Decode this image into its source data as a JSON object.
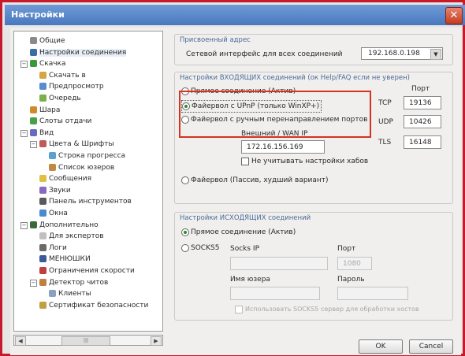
{
  "window": {
    "title": "Настройки"
  },
  "tree": [
    {
      "label": "Общие",
      "icon": "gear-icon",
      "color": "#8a8a8a"
    },
    {
      "label": "Настройки соединения",
      "icon": "network-icon",
      "color": "#3a6ea5"
    },
    {
      "label": "Скачка",
      "icon": "download-icon",
      "color": "#3a9a3a"
    },
    {
      "label": "Скачать в",
      "icon": "folder-icon",
      "color": "#d4a640"
    },
    {
      "label": "Предпросмотр",
      "icon": "preview-icon",
      "color": "#5a8ad0"
    },
    {
      "label": "Очередь",
      "icon": "queue-icon",
      "color": "#7ab04a"
    },
    {
      "label": "Шара",
      "icon": "share-icon",
      "color": "#d08a2a"
    },
    {
      "label": "Слоты отдачи",
      "icon": "upload-icon",
      "color": "#4aa04a"
    },
    {
      "label": "Вид",
      "icon": "view-icon",
      "color": "#6a6ac0"
    },
    {
      "label": "Цвета & Шрифты",
      "icon": "palette-icon",
      "color": "#c05a5a"
    },
    {
      "label": "Строка прогресса",
      "icon": "progress-icon",
      "color": "#5aa0d0"
    },
    {
      "label": "Список юзеров",
      "icon": "users-icon",
      "color": "#c08a40"
    },
    {
      "label": "Сообщения",
      "icon": "message-icon",
      "color": "#e0c040"
    },
    {
      "label": "Звуки",
      "icon": "sound-icon",
      "color": "#8a6ac0"
    },
    {
      "label": "Панель инструментов",
      "icon": "toolbar-icon",
      "color": "#5a5a5a"
    },
    {
      "label": "Окна",
      "icon": "windows-icon",
      "color": "#4a8ad0"
    },
    {
      "label": "Дополнительно",
      "icon": "advanced-icon",
      "color": "#3a6a3a"
    },
    {
      "label": "Для экспертов",
      "icon": "expert-icon",
      "color": "#c0c0c0"
    },
    {
      "label": "Логи",
      "icon": "log-icon",
      "color": "#6a6a6a"
    },
    {
      "label": "МЕНЮШКИ",
      "icon": "menu-icon",
      "color": "#3a5a9a"
    },
    {
      "label": "Ограничения скорости",
      "icon": "speed-icon",
      "color": "#c04040"
    },
    {
      "label": "Детектор читов",
      "icon": "detector-icon",
      "color": "#c08040"
    },
    {
      "label": "Клиенты",
      "icon": "clients-icon",
      "color": "#8aa0c0"
    },
    {
      "label": "Сертификат безопасности",
      "icon": "certificate-icon",
      "color": "#c0a040"
    }
  ],
  "bind": {
    "section_title": "Присвоенный адрес",
    "iface_label": "Сетевой интерфейс для всех соединений",
    "iface_value": "192.168.0.198",
    "incoming_title": "Настройки ВХОДЯЩИХ соединений (ок Help/FAQ если не уверен)",
    "radio_direct": "Прямое соединение (Актив)",
    "radio_upnp": "Файервол с UPnP (только WinXP+)",
    "radio_manual": "Файервол с ручным перенаправлением портов",
    "wan_label": "Внешний / WAN IP",
    "wan_value": "172.16.156.169",
    "hubs_label": "Не учитывать настройки хабов",
    "radio_passive": "Файервол (Пассив, худший вариант)",
    "port_header": "Порт",
    "tcp_label": "TCP",
    "tcp_value": "19136",
    "udp_label": "UDP",
    "udp_value": "10426",
    "tls_label": "TLS",
    "tls_value": "16148",
    "outgoing_title": "Настройки ИСХОДЯЩИХ соединений",
    "out_direct": "Прямое соединение (Актив)",
    "out_socks": "SOCKS5",
    "socks_ip_label": "Socks IP",
    "socks_port_label": "Порт",
    "socks_port_value": "1080",
    "user_label": "Имя юзера",
    "pass_label": "Пароль",
    "socks_check_label": "Использовать SOCKS5 сервер для обработки хостов",
    "ok_label": "OK",
    "cancel_label": "Cancel"
  }
}
